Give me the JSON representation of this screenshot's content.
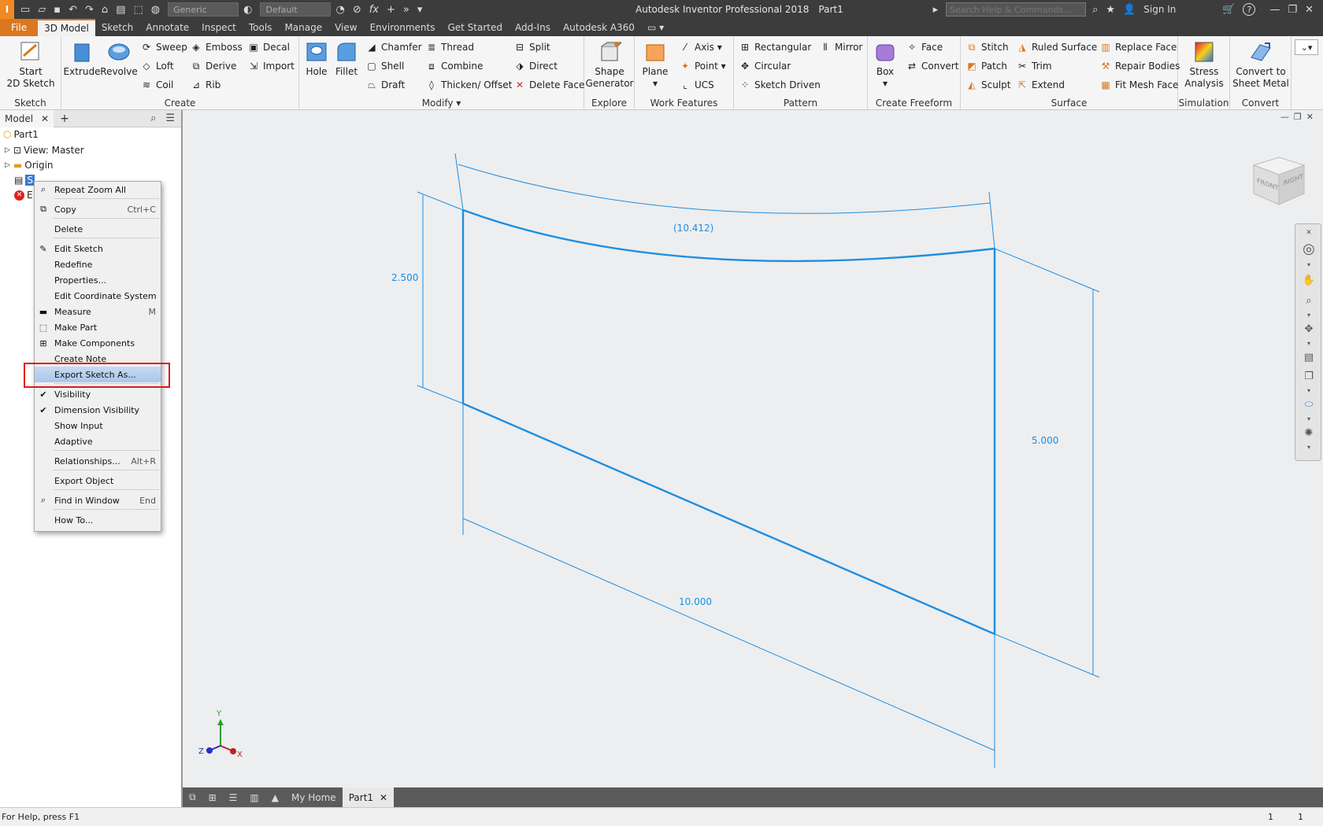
{
  "titlebar": {
    "app_title": "Autodesk Inventor Professional 2018",
    "doc_title": "Part1",
    "material": "Generic",
    "appearance": "Default",
    "fx": "fx",
    "search_placeholder": "Search Help & Commands...",
    "sign_in": "Sign In",
    "help": "?"
  },
  "tabs": [
    "File",
    "3D Model",
    "Sketch",
    "Annotate",
    "Inspect",
    "Tools",
    "Manage",
    "View",
    "Environments",
    "Get Started",
    "Add-Ins",
    "Autodesk A360"
  ],
  "ribbon": {
    "sketch": {
      "title": "Sketch",
      "start_line1": "Start",
      "start_line2": "2D Sketch"
    },
    "create": {
      "title": "Create",
      "extrude": "Extrude",
      "revolve": "Revolve",
      "sweep": "Sweep",
      "loft": "Loft",
      "coil": "Coil",
      "emboss": "Emboss",
      "derive": "Derive",
      "rib": "Rib",
      "decal": "Decal",
      "import": "Import"
    },
    "modify": {
      "title": "Modify",
      "hole": "Hole",
      "fillet": "Fillet",
      "chamfer": "Chamfer",
      "shell": "Shell",
      "draft": "Draft",
      "thread": "Thread",
      "combine": "Combine",
      "thicken": "Thicken/ Offset",
      "split": "Split",
      "direct": "Direct",
      "delete_face": "Delete Face"
    },
    "explore": {
      "title": "Explore",
      "shape_line1": "Shape",
      "shape_line2": "Generator"
    },
    "work": {
      "title": "Work Features",
      "plane": "Plane",
      "axis": "Axis",
      "point": "Point",
      "ucs": "UCS"
    },
    "pattern": {
      "title": "Pattern",
      "rectangular": "Rectangular",
      "circular": "Circular",
      "sketch_driven": "Sketch Driven",
      "mirror": "Mirror"
    },
    "freeform": {
      "title": "Create Freeform",
      "box": "Box",
      "face": "Face",
      "convert": "Convert"
    },
    "surface": {
      "title": "Surface",
      "stitch": "Stitch",
      "patch": "Patch",
      "sculpt": "Sculpt",
      "ruled": "Ruled Surface",
      "trim": "Trim",
      "extend": "Extend",
      "replace": "Replace Face",
      "repair": "Repair Bodies",
      "fit_mesh": "Fit Mesh Face"
    },
    "simulation": {
      "title": "Simulation",
      "line1": "Stress",
      "line2": "Analysis"
    },
    "convert": {
      "title": "Convert",
      "line1": "Convert to",
      "line2": "Sheet Metal"
    }
  },
  "browser": {
    "tab_label": "Model",
    "add": "+",
    "tree": {
      "part": "Part1",
      "view": "View: Master",
      "origin": "Origin",
      "sketch_short": "S",
      "end_short": "E"
    }
  },
  "context_menu": {
    "items": [
      {
        "label": "Repeat Zoom All",
        "shortcut": ""
      },
      {
        "label": "Copy",
        "shortcut": "Ctrl+C"
      },
      {
        "label": "Delete",
        "shortcut": ""
      },
      {
        "label": "Edit Sketch",
        "shortcut": ""
      },
      {
        "label": "Redefine",
        "shortcut": ""
      },
      {
        "label": "Properties...",
        "shortcut": ""
      },
      {
        "label": "Edit Coordinate System",
        "shortcut": ""
      },
      {
        "label": "Measure",
        "shortcut": "M"
      },
      {
        "label": "Make Part",
        "shortcut": ""
      },
      {
        "label": "Make Components",
        "shortcut": ""
      },
      {
        "label": "Create Note",
        "shortcut": ""
      },
      {
        "label": "Export Sketch As...",
        "shortcut": ""
      },
      {
        "label": "Visibility",
        "shortcut": ""
      },
      {
        "label": "Dimension Visibility",
        "shortcut": ""
      },
      {
        "label": "Show Input",
        "shortcut": ""
      },
      {
        "label": "Adaptive",
        "shortcut": ""
      },
      {
        "label": "Relationships...",
        "shortcut": "Alt+R"
      },
      {
        "label": "Export Object",
        "shortcut": ""
      },
      {
        "label": "Find in Window",
        "shortcut": "End"
      },
      {
        "label": "How To...",
        "shortcut": ""
      }
    ]
  },
  "sketch": {
    "dim_arc": "(10.412)",
    "dim_left": "2.500",
    "dim_right": "5.000",
    "dim_bottom": "10.000"
  },
  "viewcube": {
    "front": "FRONT",
    "right": "RIGHT"
  },
  "triad": {
    "x": "X",
    "y": "Y",
    "z": "Z"
  },
  "doc_tabs": {
    "home": "My Home",
    "part": "Part1"
  },
  "status": {
    "help": "For Help, press F1",
    "count1": "1",
    "count2": "1"
  },
  "colors": {
    "sketch_blue": "#1d8fe0",
    "accent": "#d9781f",
    "highlight_red": "#e0151c"
  }
}
